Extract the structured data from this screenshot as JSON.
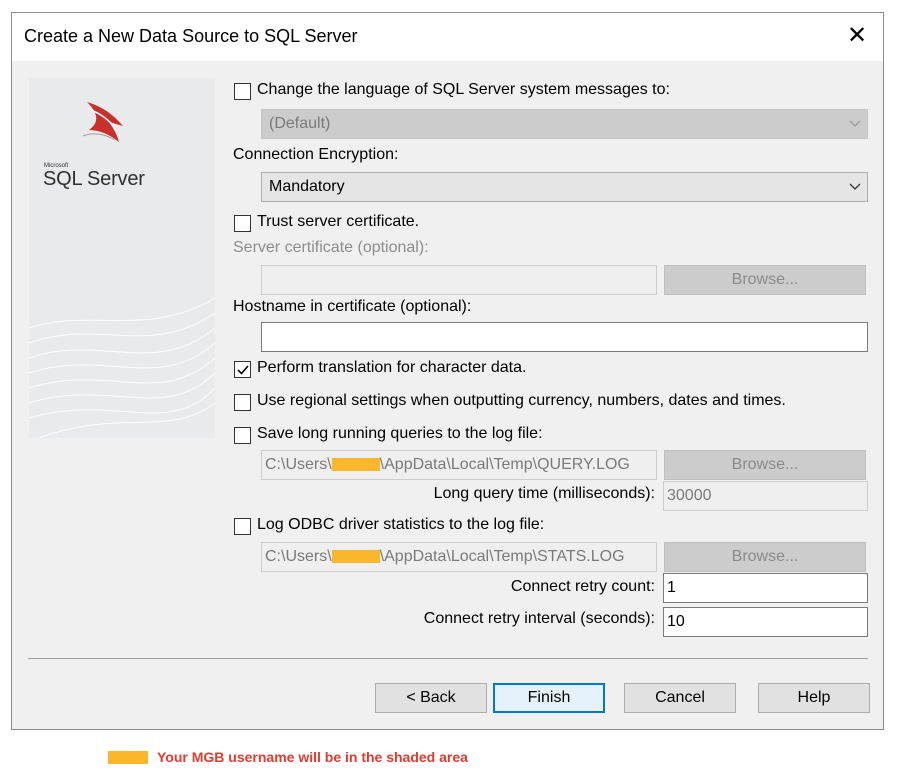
{
  "window": {
    "title": "Create a New Data Source to SQL Server",
    "close_glyph": "✕"
  },
  "banner": {
    "microsoft": "Microsoft",
    "product": "SQL Server"
  },
  "language": {
    "checkbox_label": "Change the language of SQL Server system messages to:",
    "checked": false,
    "value": "(Default)"
  },
  "encryption": {
    "label": "Connection Encryption:",
    "value": "Mandatory"
  },
  "trust_cert": {
    "checkbox_label": "Trust server certificate.",
    "checked": false
  },
  "server_cert": {
    "label": "Server certificate (optional):",
    "value": "",
    "browse": "Browse..."
  },
  "hostname": {
    "label": "Hostname in certificate (optional):",
    "value": ""
  },
  "translation": {
    "checkbox_label": "Perform translation for character data.",
    "checked": true
  },
  "regional": {
    "checkbox_label": "Use regional settings when outputting currency, numbers, dates and times.",
    "checked": false
  },
  "long_queries": {
    "checkbox_label": "Save long running queries to the log file:",
    "checked": false,
    "path_prefix": "C:\\Users\\",
    "path_suffix": "\\AppData\\Local\\Temp\\QUERY.LOG",
    "browse": "Browse...",
    "time_label": "Long query time (milliseconds):",
    "time_value": "30000"
  },
  "odbc_stats": {
    "checkbox_label": "Log ODBC driver statistics to the log file:",
    "checked": false,
    "path_prefix": "C:\\Users\\",
    "path_suffix": "\\AppData\\Local\\Temp\\STATS.LOG",
    "browse": "Browse..."
  },
  "retry": {
    "count_label": "Connect retry count:",
    "count_value": "1",
    "interval_label": "Connect retry interval (seconds):",
    "interval_value": "10"
  },
  "buttons": {
    "back": "< Back",
    "finish": "Finish",
    "cancel": "Cancel",
    "help": "Help"
  },
  "legend": {
    "text": "Your MGB username will be in the shaded area",
    "swatch_color": "#fbb72b",
    "text_color": "#e23b2e"
  }
}
